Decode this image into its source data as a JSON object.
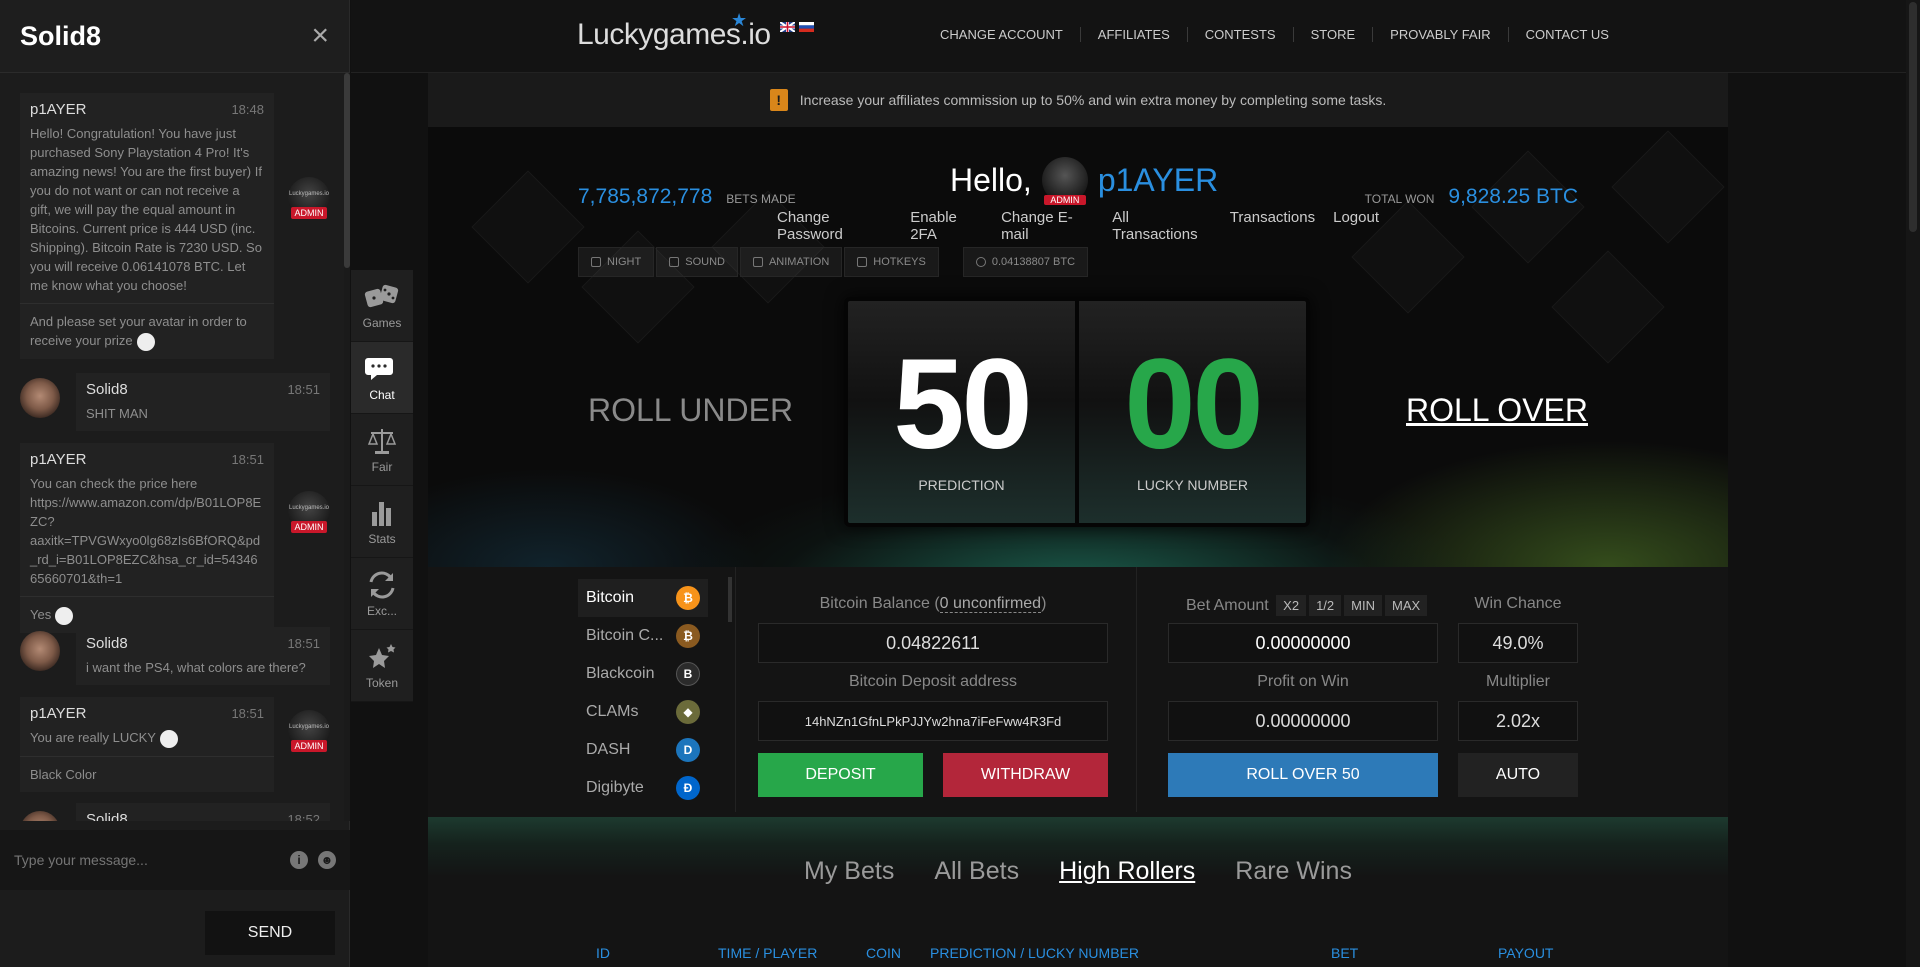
{
  "chat": {
    "username": "Solid8",
    "close_icon": "×",
    "messages": [
      {
        "name": "p1AYER",
        "time": "18:48",
        "text": "Hello! Congratulation! You have just purchased Sony Playstation 4 Pro! It's amazing news! You are the first buyer) If you do not want or can not receive a gift, we will pay the equal amount in Bitcoins. Current price is 444 USD (inc. Shipping). Bitcoin Rate is 7230 USD. So you will receive 0.06141078 BTC. Let me know what you choose!",
        "text2": "And please set your avatar in order to receive your prize"
      },
      {
        "name": "Solid8",
        "time": "18:51",
        "text": "SHIT MAN"
      },
      {
        "name": "p1AYER",
        "time": "18:51",
        "text": "You can check the price here https://www.amazon.com/dp/B01LOP8EZC?aaxitk=TPVGWxyo0lg68zIs6BfORQ&pd_rd_i=B01LOP8EZC&hsa_cr_id=5434665660701&th=1",
        "text2": "Yes"
      },
      {
        "name": "Solid8",
        "time": "18:51",
        "text": "i want the PS4, what colors are there?"
      },
      {
        "name": "p1AYER",
        "time": "18:51",
        "text": "You are really LUCKY",
        "text2": "Black Color"
      },
      {
        "name": "Solid8",
        "time": "18:52"
      }
    ],
    "admin_badge": "ADMIN",
    "admin_logo": "Luckygames.io",
    "input_placeholder": "Type your message...",
    "send_label": "SEND",
    "info_icon": "i",
    "emoji_icon": "☻"
  },
  "sidenav": [
    {
      "label": "Games",
      "icon": "dice-icon"
    },
    {
      "label": "Chat",
      "icon": "chat-icon",
      "active": true
    },
    {
      "label": "Fair",
      "icon": "scales-icon"
    },
    {
      "label": "Stats",
      "icon": "bar-chart-icon"
    },
    {
      "label": "Exc...",
      "icon": "exchange-icon"
    },
    {
      "label": "Token",
      "icon": "stars-icon"
    }
  ],
  "header": {
    "logo": "Luckygames.io",
    "nav": [
      "CHANGE ACCOUNT",
      "AFFILIATES",
      "CONTESTS",
      "STORE",
      "PROVABLY FAIR",
      "CONTACT US"
    ]
  },
  "notice": {
    "icon": "!",
    "text": "Increase your affiliates commission up to 50% and win extra money by completing some tasks."
  },
  "hero": {
    "bets_made": "7,785,872,778",
    "bets_made_label": "BETS MADE",
    "hello": "Hello,",
    "player": "p1AYER",
    "admin_badge": "ADMIN",
    "total_won_label": "TOTAL WON",
    "total_won": "9,828.25 BTC",
    "links": [
      "Change Password",
      "Enable 2FA",
      "Change E-mail",
      "All Transactions",
      "Transactions",
      "Logout"
    ],
    "toggles": [
      "NIGHT",
      "SOUND",
      "ANIMATION",
      "HOTKEYS"
    ],
    "wallet": "0.04138807 BTC",
    "roll_under": "ROLL UNDER",
    "roll_over": "ROLL OVER",
    "prediction": "50",
    "prediction_label": "PREDICTION",
    "lucky_number": "00",
    "lucky_label": "LUCKY NUMBER"
  },
  "coins": [
    {
      "name": "Bitcoin",
      "color": "#f7931a",
      "glyph": "₿",
      "active": true
    },
    {
      "name": "Bitcoin C...",
      "color": "#8a5a20",
      "glyph": "₿"
    },
    {
      "name": "Blackcoin",
      "color": "#2b2b2b",
      "glyph": "B"
    },
    {
      "name": "CLAMs",
      "color": "#6b6b3a",
      "glyph": "◆"
    },
    {
      "name": "DASH",
      "color": "#1c75bc",
      "glyph": "D"
    },
    {
      "name": "Digibyte",
      "color": "#0066cc",
      "glyph": "Ð"
    }
  ],
  "wallet": {
    "balance_label": "Bitcoin Balance (",
    "unconfirmed": "0 unconfirmed",
    "balance_label_end": ")",
    "balance": "0.04822611",
    "deposit_label": "Bitcoin Deposit address",
    "address": "14hNZn1GfnLPkPJJYw2hna7iFeFww4R3Fd",
    "deposit_btn": "DEPOSIT",
    "withdraw_btn": "WITHDRAW"
  },
  "bet": {
    "amount_label": "Bet Amount",
    "chips": [
      "X2",
      "1/2",
      "MIN",
      "MAX"
    ],
    "amount": "0.00000000",
    "win_chance_label": "Win Chance",
    "win_chance": "49.0%",
    "profit_label": "Profit on Win",
    "profit": "0.00000000",
    "multiplier_label": "Multiplier",
    "multiplier": "2.02x",
    "roll_btn": "ROLL OVER 50",
    "auto_btn": "AUTO"
  },
  "bets_tabs": [
    "My Bets",
    "All Bets",
    "High Rollers",
    "Rare Wins"
  ],
  "active_tab": "High Rollers",
  "table_headers": [
    "ID",
    "TIME / PLAYER",
    "COIN",
    "PREDICTION / LUCKY NUMBER",
    "BET",
    "PAYOUT"
  ],
  "colors": {
    "accent": "#2a8fe0",
    "green": "#27a74a",
    "red": "#b3263a",
    "blue": "#2d7ab8",
    "admin": "#c9172a"
  }
}
